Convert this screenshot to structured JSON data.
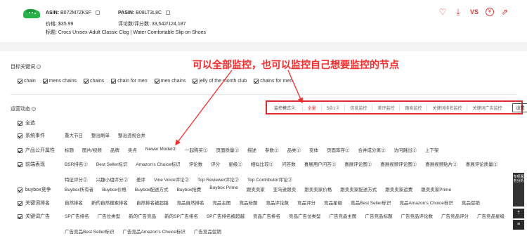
{
  "product": {
    "asin_label": "ASIN:",
    "asin": "B072M7ZKSF",
    "pasin_label": "PASIN:",
    "pasin": "B08LT3L8C",
    "price_label": "价格:",
    "price": "$35.99",
    "rating_label": "评论数/评分数:",
    "rating": "33,542/124,187",
    "title_label": "标题:",
    "title": "Crocs Unisex-Adult Classic Clog | Water Comfortable Slip on Shoes",
    "vs_label": "VS"
  },
  "annotation": "可以全部监控，也可以监控自己想要监控的节点",
  "keywords": {
    "title": "目标关键词",
    "items": [
      "chain",
      "mens chains",
      "chains",
      "chain for men",
      "men chains",
      "jelly of the month club",
      "chains for men"
    ]
  },
  "dynamics": {
    "title": "运营动态"
  },
  "mode": {
    "label": "监控模式②:",
    "options": [
      "全量",
      "5合1②",
      "信息监控",
      "差评监控",
      "跟卖监控",
      "关键词排名监控",
      "关键词广告监控"
    ],
    "active_index": 0,
    "settings_label": "设置"
  },
  "categories": [
    {
      "label": "全选",
      "items": []
    },
    {
      "label": "系统事件",
      "items": [
        "重大节日",
        "整治刷单",
        "整治违规合并"
      ]
    },
    {
      "label": "产品公开属性",
      "items": [
        "标题",
        "图片/视频",
        "品牌",
        "卖点",
        "Newer Model②",
        "一起购买②",
        "页面质量②",
        "描述",
        "参数②",
        "品类②",
        "变体",
        "页面库存②",
        "合并成分离②",
        "访问跳出②",
        "上下架"
      ]
    },
    {
      "label": "前端表现",
      "items": [
        "BSR排名②",
        "Best Seller标识",
        "Amazon's Choice标识",
        "评论数",
        "评分",
        "星级②",
        "相似比较②",
        "问答数",
        "喜展用户问答②",
        "喜展评论图②",
        "喜展视频评论图②",
        "喜展视频贴片②",
        "喜展评论质量②",
        "特征评分②",
        "兴趣小组评分②",
        "差评",
        "Vine Voice评论②",
        "Top Reviewer评论②",
        "Top Contributor评论②"
      ]
    },
    {
      "label": "buybox竞争",
      "items": [
        "Buybox所有者",
        "Buybox价格",
        "Buybox配送方式",
        "Buybox抢费",
        "Buybox Prime",
        "跟卖卖家",
        "亚马逊跟卖",
        "跟卖卖家价格",
        "跟卖卖家配送方式",
        "跟卖卖家运费",
        "跟卖卖家Prime"
      ]
    },
    {
      "label": "关键词排名",
      "items": [
        "自然排名",
        "新的自然搜索排名",
        "自然排名被超越",
        "竞品自然排名",
        "竞品主图",
        "竞品标题",
        "竞品评论数",
        "竞品评分",
        "竞品星级",
        "竞品Best Seller标识",
        "竞品Amazon's Choice标识",
        "竞品促销"
      ]
    },
    {
      "label": "关键词广告",
      "items": [
        "SP广告排名",
        "广告位类型",
        "新的广告竞品",
        "新的SP广告排名",
        "SP广告排名被超越",
        "竞品广告排名",
        "竞品广告位类型",
        "广告竞品主图",
        "广告竞品标题",
        "广告竞品评论数",
        "广告竞品评分",
        "广告竞品星级",
        "广告竞品Best Seller标识",
        "广告竞品Amazon's Choice标识",
        "广告竞品促销"
      ]
    }
  ],
  "float": {
    "tab_label": "专项服务分析",
    "btn1_label": "⇡",
    "btn2_label": "≡"
  }
}
